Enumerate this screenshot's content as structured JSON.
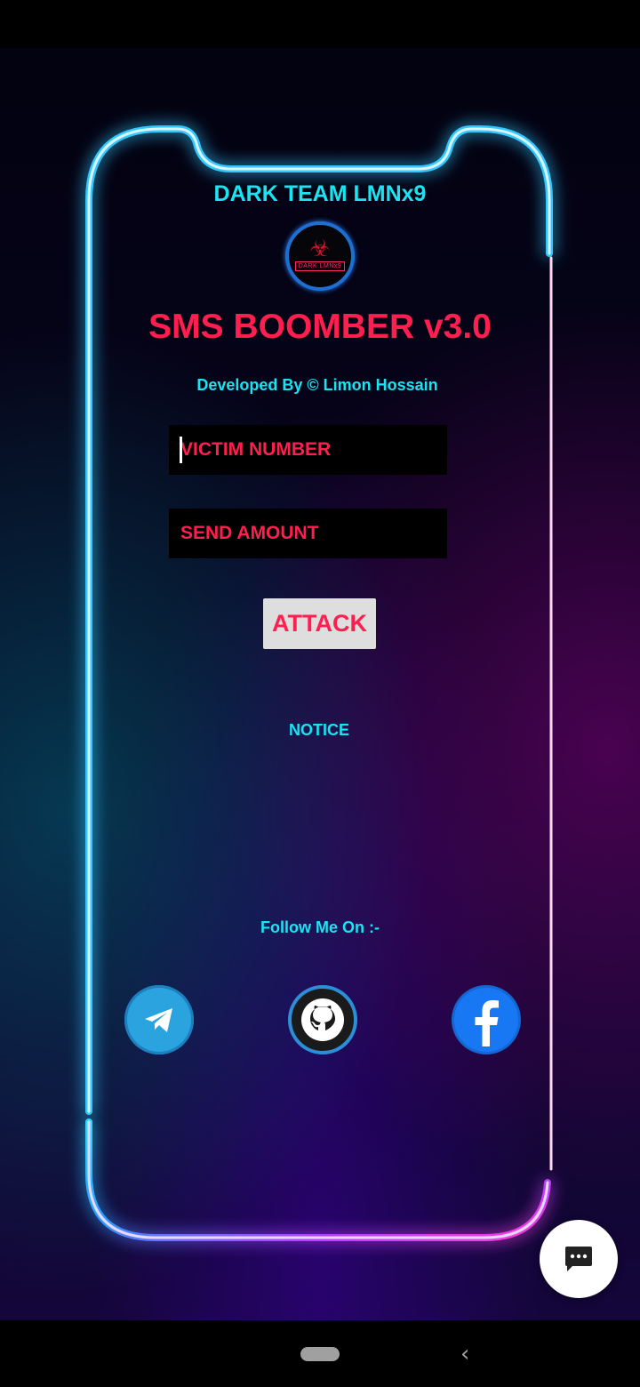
{
  "header": {
    "team_name": "DARK TEAM LMNx9",
    "logo_text": "DARK LMNx9",
    "app_title": "SMS BOOMBER v3.0",
    "developer_line": "Developed By © Limon Hossain"
  },
  "form": {
    "victim_placeholder": "VICTIM NUMBER",
    "amount_placeholder": "SEND AMOUNT",
    "attack_label": "ATTACK"
  },
  "notice_label": "NOTICE",
  "follow_label": "Follow Me On :-",
  "social": [
    {
      "name": "telegram",
      "icon": "telegram-icon"
    },
    {
      "name": "github",
      "icon": "github-icon"
    },
    {
      "name": "facebook",
      "icon": "facebook-icon"
    }
  ],
  "colors": {
    "accent_cyan": "#18e4f2",
    "accent_red": "#ff1f4f",
    "button_bg": "#dedede",
    "field_bg": "#000000"
  },
  "nav": {
    "back_glyph": "‹"
  }
}
